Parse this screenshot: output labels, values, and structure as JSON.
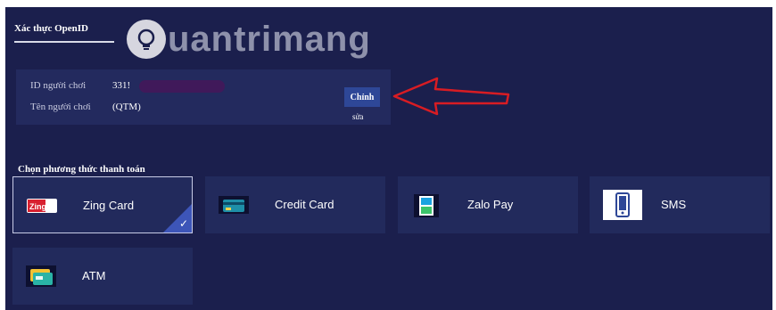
{
  "auth": {
    "title": "Xác thực OpenID",
    "id_label": "ID người chơi",
    "id_value": "331!",
    "name_label": "Tên người chơi",
    "name_value": "(QTM)",
    "edit_button": "Chỉnh",
    "edit_sub": "sửa"
  },
  "watermark": {
    "text": "uantrimang"
  },
  "payment": {
    "title": "Chọn phương thức thanh toán",
    "methods": [
      {
        "label": "Zing Card",
        "icon": "zing-card-icon",
        "selected": true
      },
      {
        "label": "Credit Card",
        "icon": "credit-card-icon",
        "selected": false
      },
      {
        "label": "Zalo Pay",
        "icon": "zalo-pay-icon",
        "selected": false
      },
      {
        "label": "SMS",
        "icon": "phone-icon",
        "selected": false
      },
      {
        "label": "ATM",
        "icon": "atm-card-icon",
        "selected": false
      }
    ]
  },
  "colors": {
    "background": "#1b1f4d",
    "card": "#222a5c",
    "accent": "#2e4797",
    "arrow": "#d81c23"
  }
}
